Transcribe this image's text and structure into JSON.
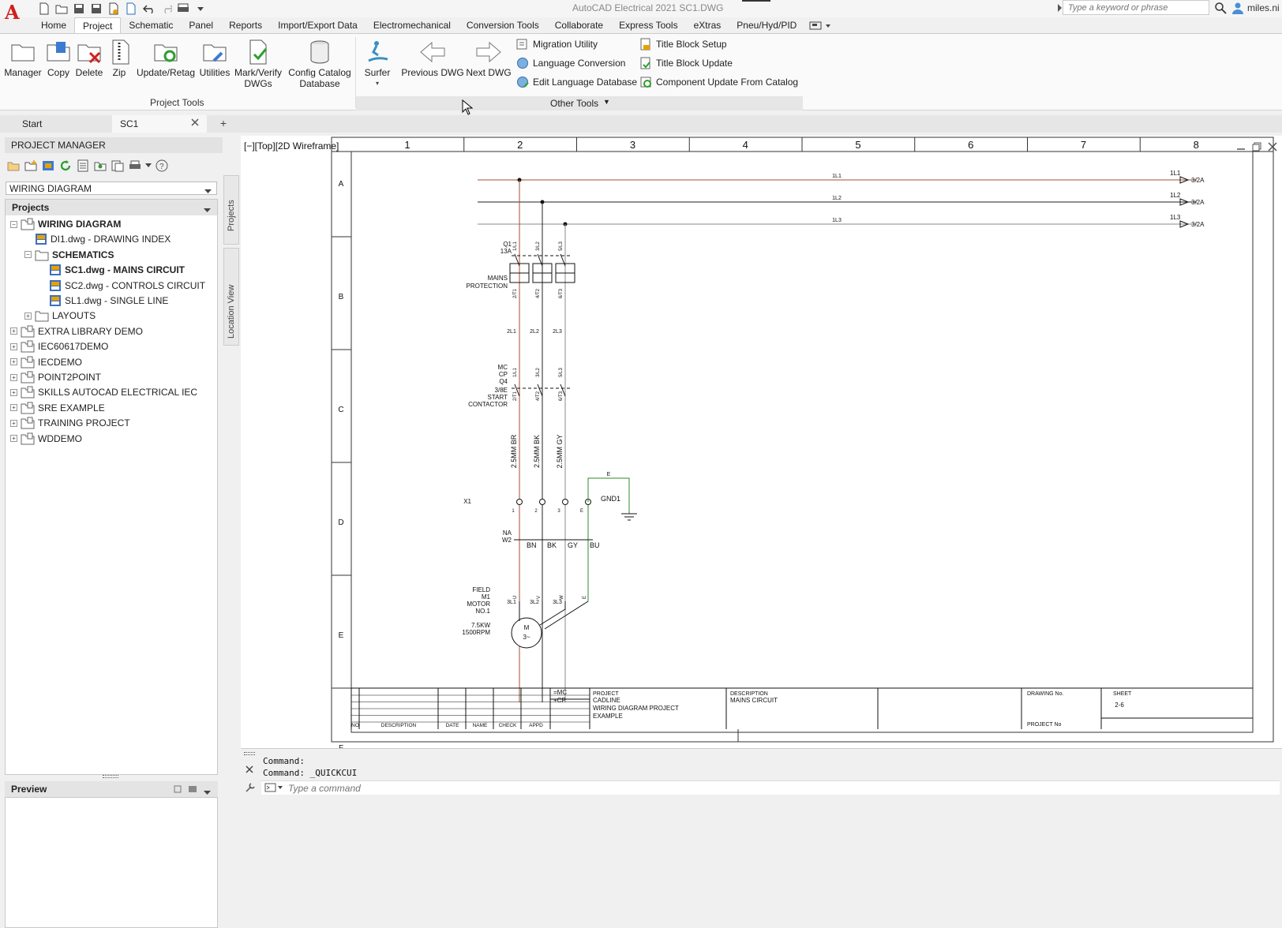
{
  "app": {
    "title": "AutoCAD Electrical 2021    SC1.DWG",
    "logo_letter": "A",
    "search_placeholder": "Type a keyword or phrase",
    "user": "miles.ni"
  },
  "ribbon_tabs": [
    "Home",
    "Project",
    "Schematic",
    "Panel",
    "Reports",
    "Import/Export Data",
    "Electromechanical",
    "Conversion Tools",
    "Collaborate",
    "Express Tools",
    "eXtras",
    "Pneu/Hyd/PID"
  ],
  "active_tab": "Project",
  "ribbon": {
    "project_tools": {
      "label": "Project Tools",
      "buttons": [
        "Manager",
        "Copy",
        "Delete",
        "Zip",
        "Update/Retag",
        "Utilities",
        "Mark/Verify\nDWGs",
        "Config Catalog\nDatabase"
      ]
    },
    "other_tools": {
      "label": "Other Tools",
      "surfer": "Surfer",
      "previous": "Previous DWG",
      "next": "Next DWG",
      "col1": [
        "Migration Utility",
        "Language Conversion",
        "Edit Language Database"
      ],
      "col2": [
        "Title Block Setup",
        "Title Block Update",
        "Component Update From Catalog"
      ]
    }
  },
  "doc_tabs": {
    "start": "Start",
    "active": "SC1"
  },
  "project_manager": {
    "title": "PROJECT MANAGER",
    "selected_project": "WIRING DIAGRAM",
    "projects_header": "Projects",
    "tree": [
      {
        "label": "WIRING DIAGRAM",
        "level": 0,
        "bold": true,
        "type": "project",
        "exp": "-"
      },
      {
        "label": "DI1.dwg - DRAWING INDEX",
        "level": 1,
        "bold": false,
        "type": "dwg"
      },
      {
        "label": "SCHEMATICS",
        "level": 1,
        "bold": true,
        "type": "folder",
        "exp": "-"
      },
      {
        "label": "SC1.dwg - MAINS CIRCUIT",
        "level": 2,
        "bold": true,
        "type": "dwg"
      },
      {
        "label": "SC2.dwg - CONTROLS CIRCUIT",
        "level": 2,
        "bold": false,
        "type": "dwg"
      },
      {
        "label": "SL1.dwg - SINGLE LINE",
        "level": 2,
        "bold": false,
        "type": "dwg"
      },
      {
        "label": "LAYOUTS",
        "level": 1,
        "bold": false,
        "type": "folder",
        "exp": "+"
      },
      {
        "label": "EXTRA LIBRARY DEMO",
        "level": 0,
        "bold": false,
        "type": "project",
        "exp": "+"
      },
      {
        "label": "IEC60617DEMO",
        "level": 0,
        "bold": false,
        "type": "project",
        "exp": "+"
      },
      {
        "label": "IECDEMO",
        "level": 0,
        "bold": false,
        "type": "project",
        "exp": "+"
      },
      {
        "label": "POINT2POINT",
        "level": 0,
        "bold": false,
        "type": "project",
        "exp": "+"
      },
      {
        "label": "SKILLS AUTOCAD ELECTRICAL IEC",
        "level": 0,
        "bold": false,
        "type": "project",
        "exp": "+"
      },
      {
        "label": "SRE EXAMPLE",
        "level": 0,
        "bold": false,
        "type": "project",
        "exp": "+"
      },
      {
        "label": "TRAINING PROJECT",
        "level": 0,
        "bold": false,
        "type": "project",
        "exp": "+"
      },
      {
        "label": "WDDEMO",
        "level": 0,
        "bold": false,
        "type": "project",
        "exp": "+"
      }
    ],
    "preview": "Preview",
    "side_tabs": [
      "Projects",
      "Location View"
    ]
  },
  "viewport": {
    "label": "[−][Top][2D Wireframe]"
  },
  "drawing": {
    "columns": [
      "1",
      "2",
      "3",
      "4",
      "5",
      "6",
      "7",
      "8"
    ],
    "rows": [
      "A",
      "B",
      "C",
      "D",
      "E",
      "F"
    ],
    "bus": [
      {
        "tag": "1L1",
        "label": "1L1",
        "ref": "3/2A"
      },
      {
        "tag": "1L2",
        "label": "1L2",
        "ref": "3/2A"
      },
      {
        "tag": "1L3",
        "label": "1L3",
        "ref": "3/2A"
      }
    ],
    "q1": {
      "tag": "Q1",
      "rating": "13A",
      "desc1": "MAINS",
      "desc2": "PROTECTION",
      "top": [
        "1/L1",
        "3/L2",
        "5/L3"
      ],
      "bot": [
        "2/T1",
        "4/T2",
        "6/T3"
      ]
    },
    "wires1": [
      "2L1",
      "2L2",
      "2L3"
    ],
    "contactor": {
      "lines": [
        "MC",
        "CP",
        "Q4",
        "3/8E",
        "START",
        "CONTACTOR"
      ],
      "top": [
        "1/L1",
        "3/L2",
        "5/L3"
      ],
      "bot": [
        "2/T1",
        "4/T2",
        "6/T3"
      ]
    },
    "cables": [
      "2.5MM  BR",
      "2.5MM  BK",
      "2.5MM  GY"
    ],
    "wires2": [
      "3L1",
      "3L2",
      "3L3"
    ],
    "terminal": {
      "tag": "X1",
      "nums": [
        "1",
        "2",
        "3",
        "E"
      ],
      "earth_wire": "E",
      "gnd": "GND1"
    },
    "cable_w2": {
      "tag1": "NA",
      "tag2": "W2",
      "cores": [
        "BN",
        "BK",
        "GY",
        "BU"
      ]
    },
    "motor": {
      "lines": [
        "FIELD",
        "M1",
        "MOTOR",
        "NO.1"
      ],
      "rating": [
        "7.5KW",
        "1500RPM"
      ],
      "sym1": "M",
      "sym2": "3~",
      "pins": [
        "U",
        "V",
        "W",
        "E"
      ]
    },
    "title_block": {
      "mc": "=MC",
      "cp": "+CP",
      "headers": [
        "NO",
        "DESCRIPTION",
        "DATE",
        "NAME",
        "CHECK",
        "APPD"
      ],
      "project_label": "PROJECT",
      "project_lines": [
        "CADLINE",
        "WIRING DIAGRAM PROJECT",
        "EXAMPLE"
      ],
      "description_label": "DESCRIPTION",
      "description": "MAINS CIRCUIT",
      "drawing_no_label": "DRAWING No.",
      "sheet_label": "SHEET",
      "sheet": "2-6",
      "project_no_label": "PROJECT No"
    }
  },
  "command": {
    "history": [
      "Command:",
      "Command: _QUICKCUI"
    ],
    "placeholder": "Type a command"
  },
  "colors": {
    "accent": "#d02020",
    "l1": "#a0522d",
    "l2": "#222222",
    "l3": "#8a8a8a",
    "earth": "#2e8b2e"
  }
}
